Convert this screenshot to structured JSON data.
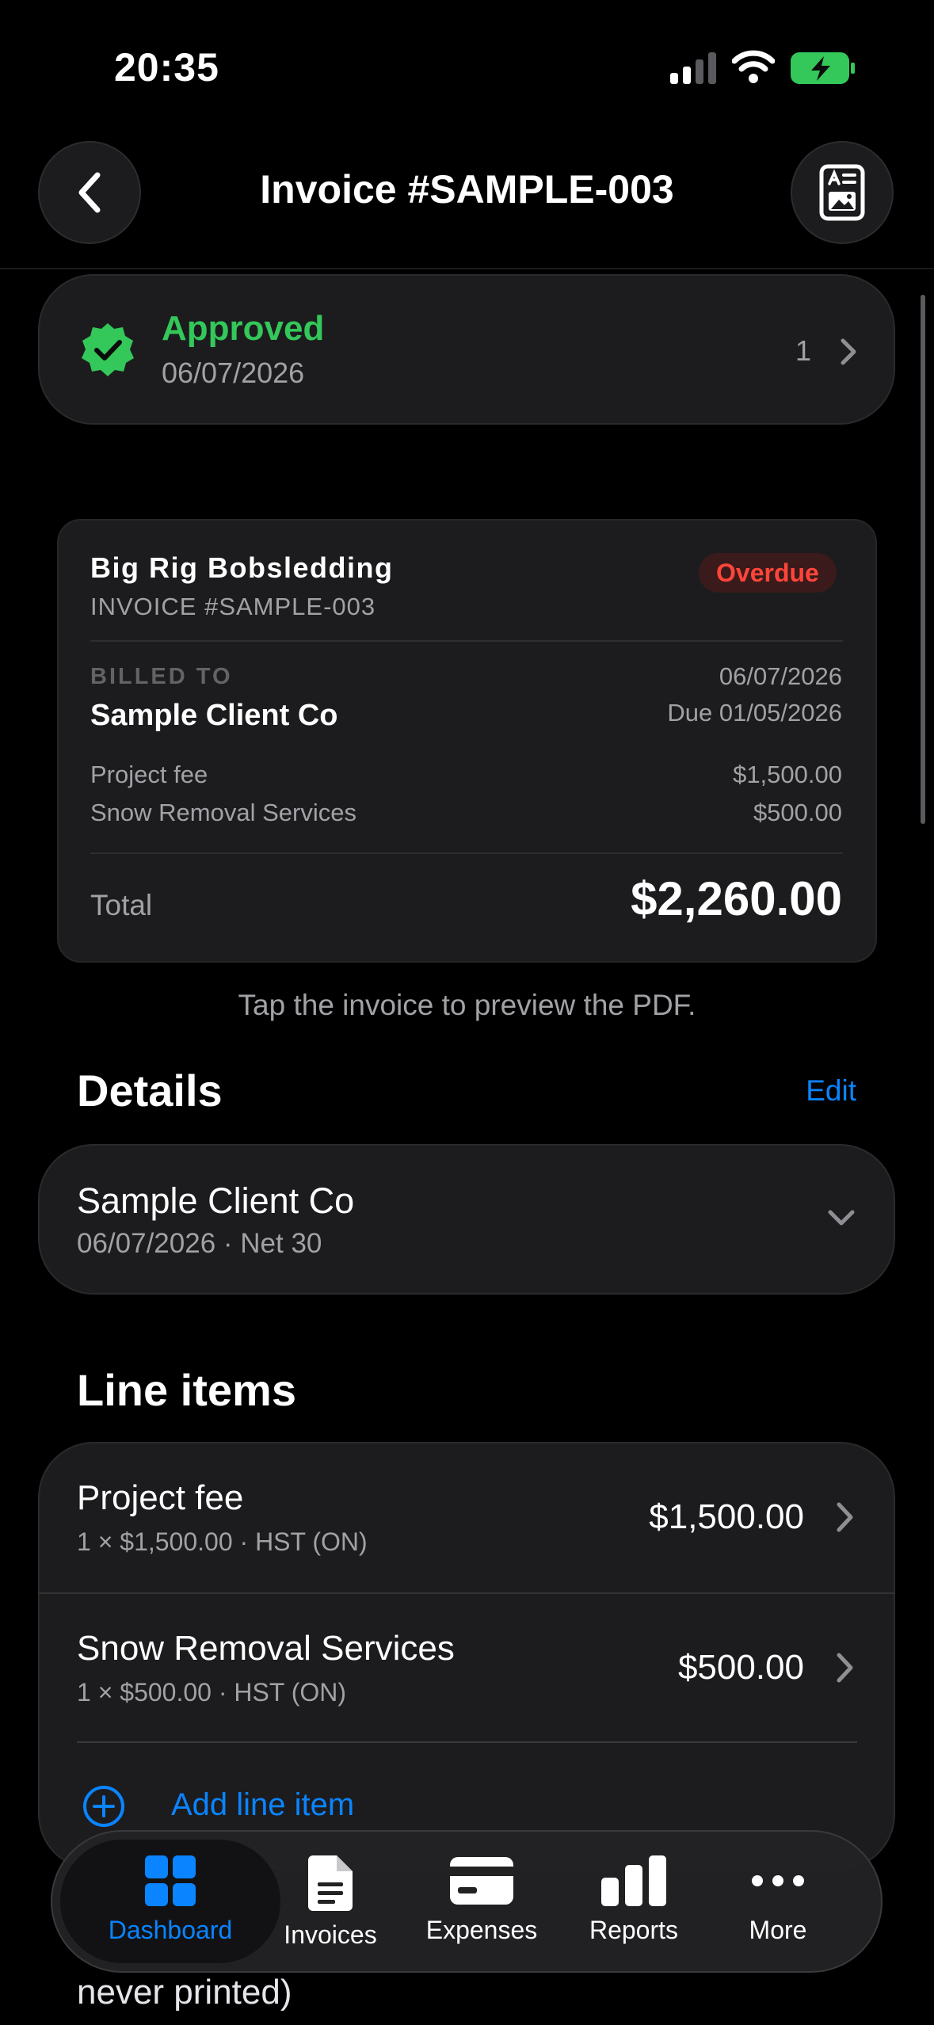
{
  "status_bar": {
    "time": "20:35"
  },
  "nav": {
    "title": "Invoice #SAMPLE-003"
  },
  "approval": {
    "status": "Approved",
    "date": "06/07/2026",
    "count": "1"
  },
  "invoice_preview": {
    "business_name": "Big Rig Bobsledding",
    "invoice_number": "INVOICE #SAMPLE-003",
    "status_badge": "Overdue",
    "billed_to_label": "BILLED TO",
    "client_name": "Sample Client Co",
    "issue_date": "06/07/2026",
    "due_date": "Due 01/05/2026",
    "lines": [
      {
        "name": "Project fee",
        "amount": "$1,500.00"
      },
      {
        "name": "Snow Removal Services",
        "amount": "$500.00"
      }
    ],
    "total_label": "Total",
    "total": "$2,260.00",
    "hint": "Tap the invoice to preview the PDF."
  },
  "details": {
    "heading": "Details",
    "edit_label": "Edit",
    "client": "Sample Client Co",
    "subtitle": "06/07/2026 · Net 30"
  },
  "line_items": {
    "heading": "Line items",
    "items": [
      {
        "title": "Project fee",
        "subtitle": "1 × $1,500.00 · HST (ON)",
        "amount": "$1,500.00"
      },
      {
        "title": "Snow Removal Services",
        "subtitle": "1 × $500.00 · HST (ON)",
        "amount": "$500.00"
      }
    ],
    "add_label": "Add line item"
  },
  "bleed_text": "never printed)",
  "tab_bar": {
    "tabs": [
      {
        "label": "Dashboard",
        "icon": "grid-icon",
        "active": true
      },
      {
        "label": "Invoices",
        "icon": "document-icon",
        "active": false
      },
      {
        "label": "Expenses",
        "icon": "card-icon",
        "active": false
      },
      {
        "label": "Reports",
        "icon": "bar-chart-icon",
        "active": false
      },
      {
        "label": "More",
        "icon": "ellipsis-icon",
        "active": false
      }
    ]
  },
  "colors": {
    "accent": "#0a84ff",
    "approved": "#34c759",
    "overdue": "#ff453a",
    "background": "#000000",
    "card": "#1c1c1e"
  }
}
